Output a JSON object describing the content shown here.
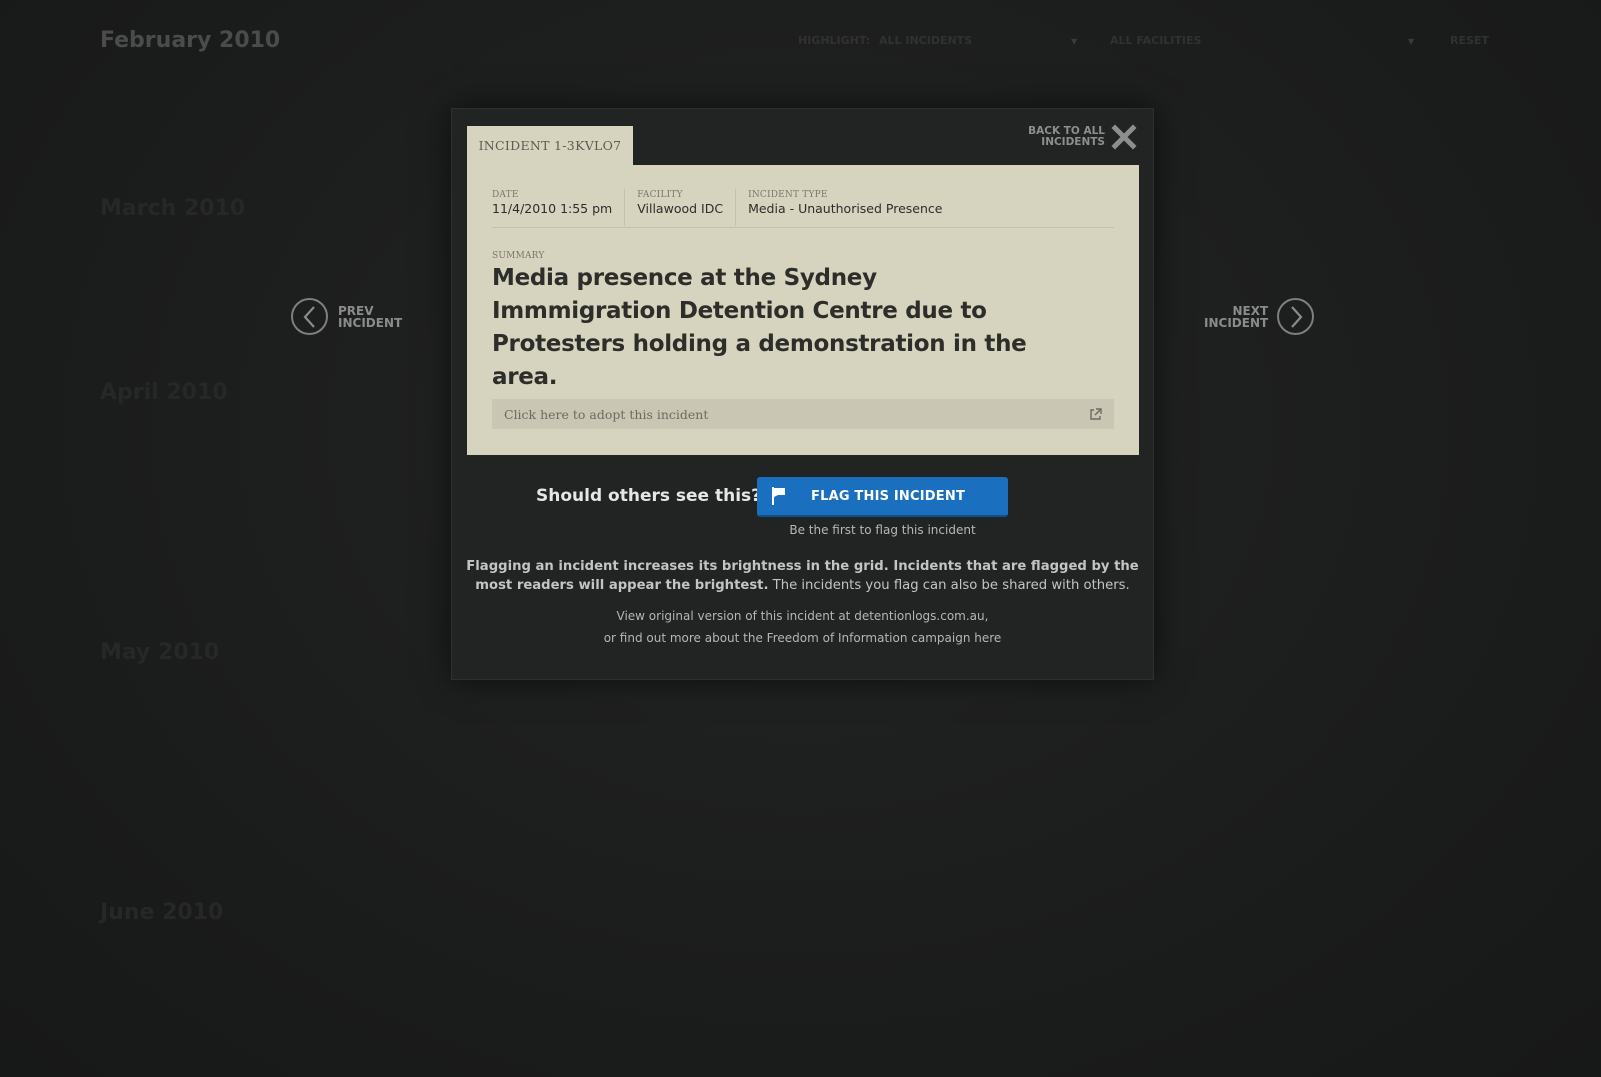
{
  "background": {
    "current_month": "February 2010",
    "months": [
      "March 2010",
      "April 2010",
      "May 2010",
      "June 2010"
    ],
    "filters": {
      "highlight_label": "HIGHLIGHT:",
      "highlight_value": "ALL INCIDENTS",
      "facility_value": "ALL FACILITIES",
      "reset_label": "RESET"
    }
  },
  "nav": {
    "prev_line1": "PREV",
    "prev_line2": "INCIDENT",
    "next_line1": "NEXT",
    "next_line2": "INCIDENT"
  },
  "modal": {
    "tab_label": "INCIDENT 1-3KVLO7",
    "close_line1": "BACK TO ALL",
    "close_line2": "INCIDENTS",
    "meta": [
      {
        "label": "DATE",
        "value": "11/4/2010 1:55 pm"
      },
      {
        "label": "FACILITY",
        "value": "Villawood IDC"
      },
      {
        "label": "INCIDENT TYPE",
        "value": "Media - Unauthorised Presence"
      }
    ],
    "summary_label": "SUMMARY",
    "summary_text": "Media presence at the Sydney Immmigration Detention Centre due to Protesters holding a demonstration in the area.",
    "adopt_label": "Click here to adopt this incident",
    "flag_question": "Should others see this?",
    "flag_button_label": "FLAG THIS INCIDENT",
    "flag_count_text": "Be the first to flag this incident",
    "explain_bold": "Flagging an incident increases its brightness in the grid. Incidents that are flagged by the most readers will appear the brightest.",
    "explain_normal": " The incidents you flag can also be shared with others.",
    "links_line1_prefix": "View original version of this incident at ",
    "links_line1_link": "detentionlogs.com.au",
    "links_line1_suffix": ",",
    "links_line2_prefix": "or find out more about the Freedom of Information campaign ",
    "links_line2_link": "here"
  },
  "colors": {
    "accent_blue": "#1a6fbe",
    "card_bg": "#d6d3bf",
    "modal_bg": "#222323"
  },
  "icons": [
    "chevron-left-icon",
    "chevron-right-icon",
    "close-icon",
    "external-link-icon",
    "flag-icon"
  ]
}
